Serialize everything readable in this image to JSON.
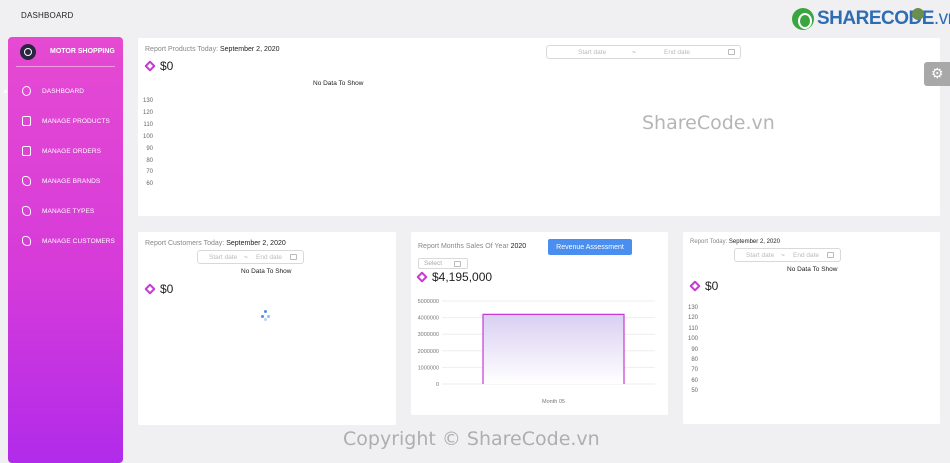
{
  "header": {
    "title": "DASHBOARD",
    "logo_main": "SHARECODE",
    "logo_suffix": ".vn"
  },
  "sidebar": {
    "brand": "MOTOR SHOPPING",
    "items": [
      {
        "label": "DASHBOARD",
        "icon": "pie-chart-icon",
        "active": true
      },
      {
        "label": "MANAGE PRODUCTS",
        "icon": "document-icon"
      },
      {
        "label": "MANAGE ORDERS",
        "icon": "document-icon"
      },
      {
        "label": "MANAGE BRANDS",
        "icon": "puzzle-icon"
      },
      {
        "label": "MANAGE TYPES",
        "icon": "puzzle-icon"
      },
      {
        "label": "MANAGE CUSTOMERS",
        "icon": "puzzle-icon"
      }
    ]
  },
  "products_today": {
    "label": "Report Products Today:",
    "date": "September 2, 2020",
    "amount": "$0",
    "start_placeholder": "Start date",
    "end_placeholder": "End date",
    "separator": "~",
    "nodata": "No Data To Show",
    "y_ticks": [
      "130",
      "120",
      "110",
      "100",
      "90",
      "80",
      "70",
      "60"
    ]
  },
  "customers_today": {
    "label": "Report Customers Today:",
    "date": "September 2, 2020",
    "amount": "$0",
    "start_placeholder": "Start date",
    "end_placeholder": "End date",
    "separator": "~",
    "nodata": "No Data To Show"
  },
  "months_sales": {
    "label": "Report Months Sales Of Year",
    "year": "2020",
    "button": "Revenue Assessment",
    "select_placeholder": "Select",
    "amount": "$4,195,000"
  },
  "today_report": {
    "label": "Report Today:",
    "date": "September 2, 2020",
    "amount": "$0",
    "start_placeholder": "Start date",
    "end_placeholder": "End date",
    "separator": "~",
    "nodata": "No Data To Show",
    "y_ticks": [
      "130",
      "120",
      "110",
      "100",
      "90",
      "80",
      "70",
      "60",
      "50"
    ]
  },
  "watermarks": {
    "center": "ShareCode.vn",
    "bottom": "Copyright © ShareCode.vn"
  },
  "chart_data": {
    "type": "area",
    "categories": [
      "Month 05"
    ],
    "series": [
      {
        "values": [
          4195000
        ]
      }
    ],
    "ylim": [
      0,
      5000000
    ],
    "y_ticks": [
      "5000000",
      "4000000",
      "3000000",
      "2000000",
      "1000000",
      "0"
    ],
    "xlabel": "",
    "ylabel": "",
    "color": "#c53ad2",
    "grid": true
  }
}
